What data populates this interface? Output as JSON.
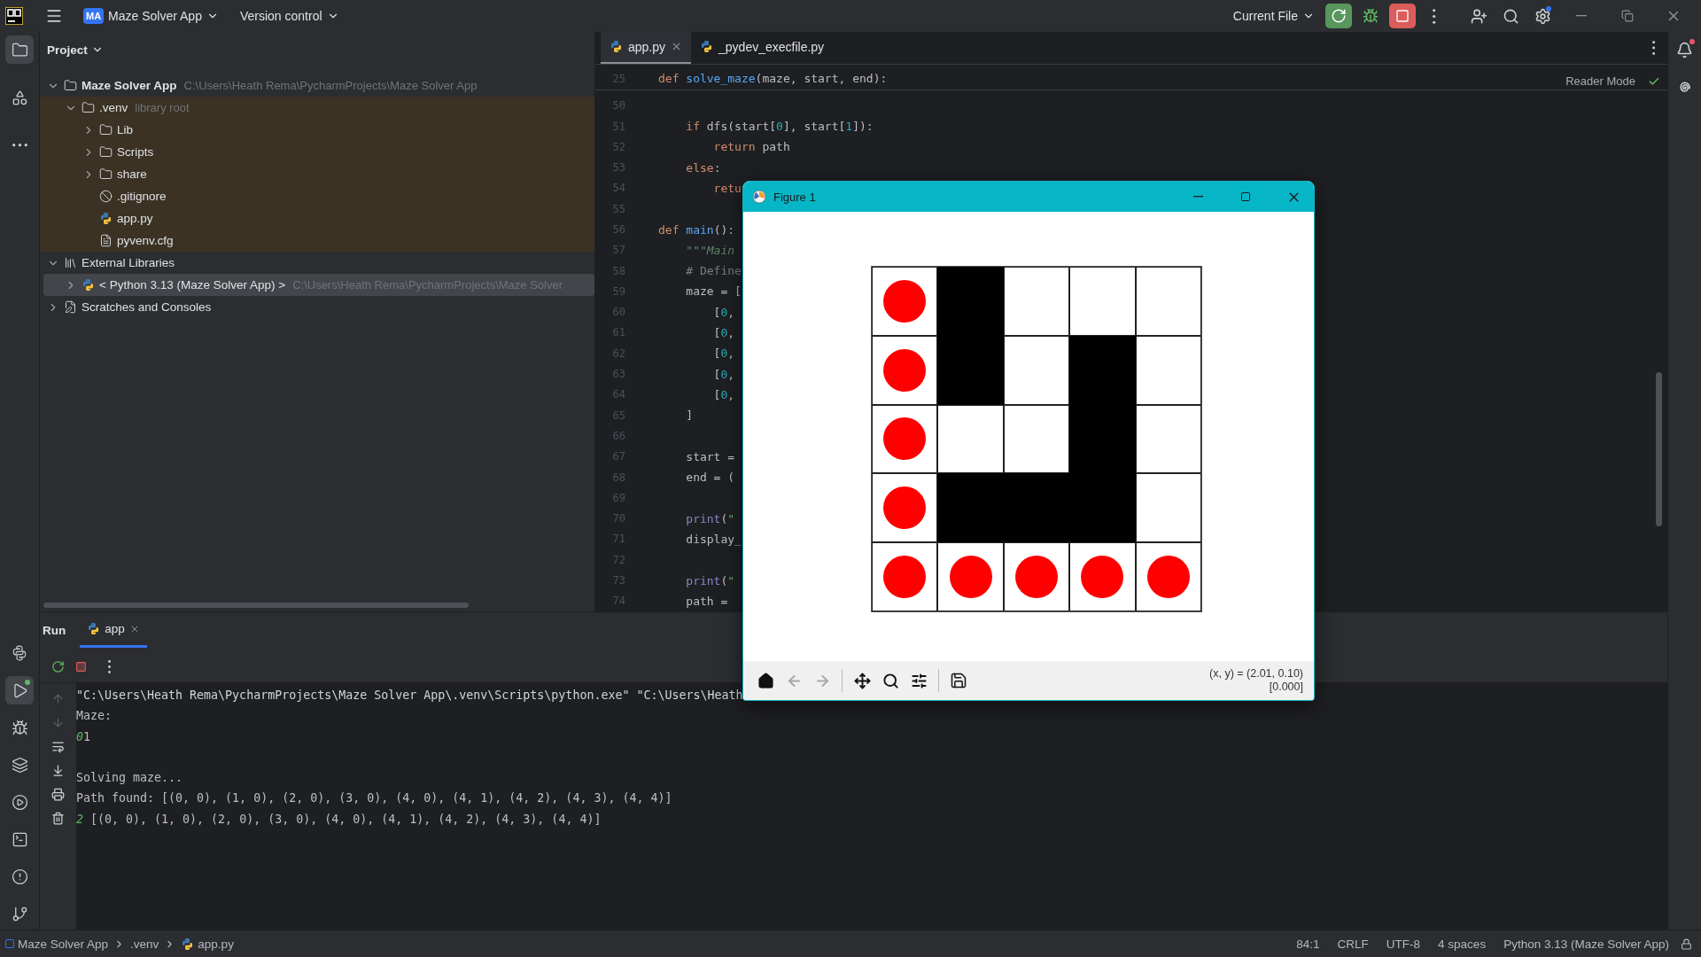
{
  "title_bar": {
    "project_badge": "MA",
    "project": "Maze Solver App",
    "vcs": "Version control",
    "run_config": "Current File"
  },
  "tool_strip": {
    "top": [
      {
        "kind": "project",
        "selected": true
      },
      {
        "kind": "structure",
        "selected": false
      },
      {
        "kind": "more",
        "selected": false
      }
    ],
    "bottom": [
      {
        "kind": "python_console",
        "selected": false
      },
      {
        "kind": "run",
        "selected": true
      },
      {
        "kind": "debug",
        "selected": false
      },
      {
        "kind": "layers",
        "selected": false
      },
      {
        "kind": "services",
        "selected": false
      },
      {
        "kind": "terminal",
        "selected": false
      },
      {
        "kind": "problems",
        "selected": false
      },
      {
        "kind": "git",
        "selected": false
      }
    ]
  },
  "project_panel": {
    "title": "Project",
    "tree": [
      {
        "kind": "folder",
        "label": "Maze Solver App",
        "hint": "C:\\Users\\Heath Rema\\PycharmProjects\\Maze Solver App",
        "expanded": true,
        "selected": false,
        "highlighted": false,
        "children": [
          {
            "kind": "folder",
            "label": ".venv",
            "hint": "library root",
            "expanded": true,
            "selected": false,
            "highlighted": true,
            "children": [
              {
                "kind": "folder",
                "label": "Lib",
                "expanded": false,
                "selected": false,
                "highlighted": true
              },
              {
                "kind": "folder",
                "label": "Scripts",
                "expanded": false,
                "selected": false,
                "highlighted": true
              },
              {
                "kind": "folder",
                "label": "share",
                "expanded": false,
                "selected": false,
                "highlighted": true
              },
              {
                "kind": "ignore",
                "label": ".gitignore",
                "selected": false,
                "highlighted": true
              },
              {
                "kind": "python",
                "label": "app.py",
                "selected": false,
                "highlighted": true
              },
              {
                "kind": "text",
                "label": "pyvenv.cfg",
                "selected": false,
                "highlighted": true
              }
            ]
          }
        ]
      },
      {
        "kind": "library",
        "label": "External Libraries",
        "expanded": true,
        "selected": false,
        "highlighted": false,
        "children": [
          {
            "kind": "python",
            "label": "< Python 3.13 (Maze Solver App) >",
            "hint": "C:\\Users\\Heath Rema\\PycharmProjects\\Maze Solver",
            "expanded": false,
            "selected": true
          }
        ]
      },
      {
        "kind": "scratch",
        "label": "Scratches and Consoles",
        "expanded": false,
        "selected": false,
        "highlighted": false
      }
    ]
  },
  "editor": {
    "tabs": [
      {
        "label": "app.py",
        "selected": true
      },
      {
        "label": "_pydev_execfile.py",
        "selected": false
      }
    ],
    "reader_mode": "Reader Mode",
    "sticky": {
      "number": "25",
      "segs": [
        {
          "kind": "keyword",
          "text": "def "
        },
        {
          "kind": "function",
          "text": "solve_maze"
        },
        {
          "kind": "plain",
          "text": "(maze, start, end):"
        }
      ]
    },
    "lines": [
      {
        "number": "50"
      },
      {
        "number": "51",
        "segs": [
          {
            "kind": "keyword",
            "text": "    if "
          },
          {
            "kind": "plain",
            "text": "dfs(start["
          },
          {
            "kind": "number",
            "text": "0"
          },
          {
            "kind": "plain",
            "text": "], start["
          },
          {
            "kind": "number",
            "text": "1"
          },
          {
            "kind": "plain",
            "text": "]):"
          }
        ]
      },
      {
        "number": "52",
        "segs": [
          {
            "kind": "keyword",
            "text": "        return "
          },
          {
            "kind": "plain",
            "text": "path"
          }
        ]
      },
      {
        "number": "53",
        "segs": [
          {
            "kind": "keyword",
            "text": "    else"
          },
          {
            "kind": "plain",
            "text": ":"
          }
        ]
      },
      {
        "number": "54",
        "segs": [
          {
            "kind": "keyword",
            "text": "        retu"
          }
        ]
      },
      {
        "number": "55"
      },
      {
        "number": "56",
        "segs": [
          {
            "kind": "keyword",
            "text": "def "
          },
          {
            "kind": "function",
            "text": "main"
          },
          {
            "kind": "plain",
            "text": "():"
          }
        ]
      },
      {
        "number": "57",
        "segs": [
          {
            "kind": "docstring",
            "text": "    \"\"\"Main"
          }
        ]
      },
      {
        "number": "58",
        "segs": [
          {
            "kind": "comment",
            "text": "    # Define"
          }
        ]
      },
      {
        "number": "59",
        "segs": [
          {
            "kind": "plain",
            "text": "    maze = ["
          }
        ]
      },
      {
        "number": "60",
        "segs": [
          {
            "kind": "plain",
            "text": "        ["
          },
          {
            "kind": "number",
            "text": "0"
          },
          {
            "kind": "plain",
            "text": ","
          }
        ]
      },
      {
        "number": "61",
        "segs": [
          {
            "kind": "plain",
            "text": "        ["
          },
          {
            "kind": "number",
            "text": "0"
          },
          {
            "kind": "plain",
            "text": ","
          }
        ]
      },
      {
        "number": "62",
        "segs": [
          {
            "kind": "plain",
            "text": "        ["
          },
          {
            "kind": "number",
            "text": "0"
          },
          {
            "kind": "plain",
            "text": ","
          }
        ]
      },
      {
        "number": "63",
        "segs": [
          {
            "kind": "plain",
            "text": "        ["
          },
          {
            "kind": "number",
            "text": "0"
          },
          {
            "kind": "plain",
            "text": ","
          }
        ]
      },
      {
        "number": "64",
        "segs": [
          {
            "kind": "plain",
            "text": "        ["
          },
          {
            "kind": "number",
            "text": "0"
          },
          {
            "kind": "plain",
            "text": ","
          }
        ]
      },
      {
        "number": "65",
        "segs": [
          {
            "kind": "plain",
            "text": "    ]"
          }
        ]
      },
      {
        "number": "66"
      },
      {
        "number": "67",
        "segs": [
          {
            "kind": "plain",
            "text": "    start ="
          }
        ]
      },
      {
        "number": "68",
        "segs": [
          {
            "kind": "plain",
            "text": "    end = ("
          }
        ]
      },
      {
        "number": "69"
      },
      {
        "number": "70",
        "segs": [
          {
            "kind": "builtin",
            "text": "    print"
          },
          {
            "kind": "plain",
            "text": "("
          },
          {
            "kind": "string",
            "text": "\""
          }
        ]
      },
      {
        "number": "71",
        "segs": [
          {
            "kind": "plain",
            "text": "    display_"
          }
        ]
      },
      {
        "number": "72"
      },
      {
        "number": "73",
        "segs": [
          {
            "kind": "builtin",
            "text": "    print"
          },
          {
            "kind": "plain",
            "text": "("
          },
          {
            "kind": "string",
            "text": "\""
          }
        ]
      },
      {
        "number": "74",
        "segs": [
          {
            "kind": "plain",
            "text": "    path = "
          }
        ]
      }
    ]
  },
  "run_panel": {
    "title": "Run",
    "tabs": [
      {
        "label": "app",
        "selected": true
      }
    ],
    "console": [
      {
        "kind": "command",
        "text": "\"C:\\Users\\Heath Rema\\PycharmProjects\\Maze Solver App\\.venv\\Scripts\\python.exe\" \"C:\\Users\\Heath"
      },
      {
        "kind": "output",
        "text": "Maze:"
      },
      {
        "kind": "output",
        "lead": "0",
        "text": "1"
      },
      {
        "kind": "blank"
      },
      {
        "kind": "output",
        "text": "Solving maze..."
      },
      {
        "kind": "output",
        "text": "Path found: [(0, 0), (1, 0), (2, 0), (3, 0), (4, 0), (4, 1), (4, 2), (4, 3), (4, 4)]"
      },
      {
        "kind": "output",
        "lead": "2",
        "text": " [(0, 0), (1, 0), (2, 0), (3, 0), (4, 0), (4, 1), (4, 2), (4, 3), (4, 4)]"
      }
    ]
  },
  "figure": {
    "title": "Figure 1",
    "maze": [
      {
        "cells": [
          {
            "kind": "path"
          },
          {
            "kind": "wall"
          },
          {
            "kind": "open"
          },
          {
            "kind": "open"
          },
          {
            "kind": "open"
          }
        ]
      },
      {
        "cells": [
          {
            "kind": "path"
          },
          {
            "kind": "wall"
          },
          {
            "kind": "open"
          },
          {
            "kind": "wall"
          },
          {
            "kind": "open"
          }
        ]
      },
      {
        "cells": [
          {
            "kind": "path"
          },
          {
            "kind": "open"
          },
          {
            "kind": "open"
          },
          {
            "kind": "wall"
          },
          {
            "kind": "open"
          }
        ]
      },
      {
        "cells": [
          {
            "kind": "path"
          },
          {
            "kind": "wall"
          },
          {
            "kind": "wall"
          },
          {
            "kind": "wall"
          },
          {
            "kind": "open"
          }
        ]
      },
      {
        "cells": [
          {
            "kind": "path"
          },
          {
            "kind": "path"
          },
          {
            "kind": "path"
          },
          {
            "kind": "path"
          },
          {
            "kind": "path"
          }
        ]
      }
    ],
    "toolbar": [
      {
        "kind": "home",
        "disabled": false
      },
      {
        "kind": "back",
        "disabled": true
      },
      {
        "kind": "forward",
        "disabled": true
      },
      {
        "kind": "pan",
        "disabled": false
      },
      {
        "kind": "zoom",
        "disabled": false
      },
      {
        "kind": "configure",
        "disabled": false
      },
      {
        "kind": "save",
        "disabled": false
      }
    ],
    "readout": [
      "(x, y) = (2.01, 0.10)",
      "[0.000]"
    ]
  },
  "status_bar": {
    "breadcrumbs": [
      {
        "kind": "module",
        "label": "Maze Solver App"
      },
      {
        "kind": "folder",
        "label": ".venv"
      },
      {
        "kind": "python",
        "label": "app.py"
      }
    ],
    "items": [
      "84:1",
      "CRLF",
      "UTF-8",
      "4 spaces",
      "Python 3.13 (Maze Solver App)"
    ]
  }
}
